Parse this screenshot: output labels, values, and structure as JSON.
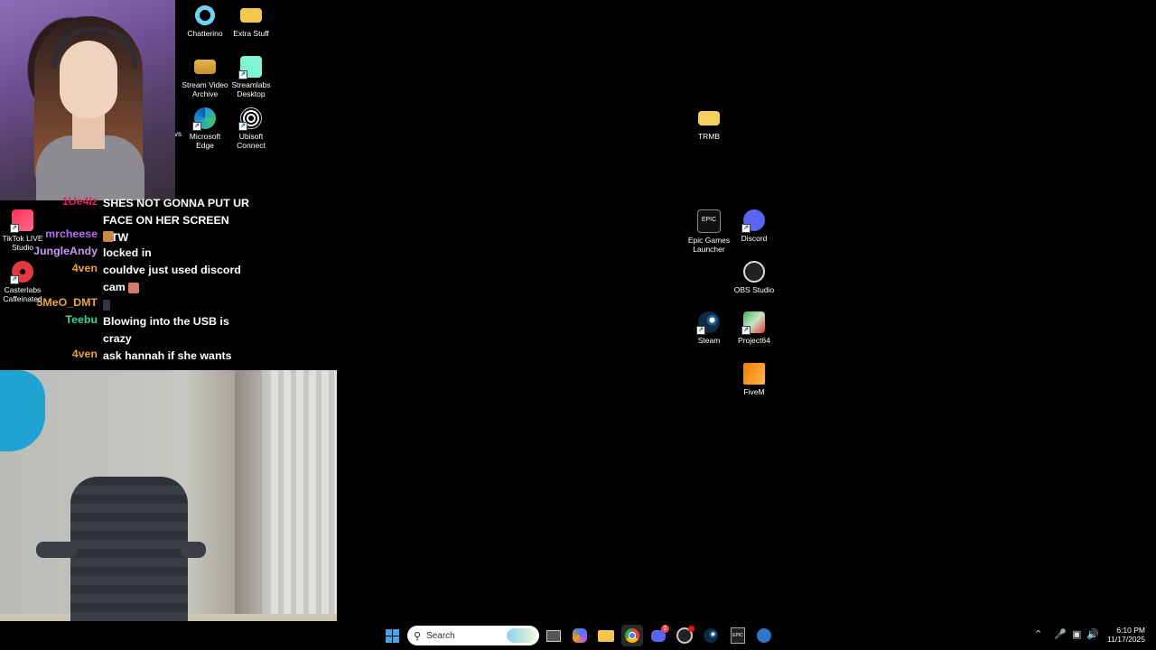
{
  "desktop_icons": {
    "chatterino": "Chatterino",
    "extra_stuff": "Extra Stuff",
    "stream_video_archive_1": "Stream Video",
    "stream_video_archive_2": "Archive",
    "streamlabs_1": "Streamlabs",
    "streamlabs_2": "Desktop",
    "edge_1": "Microsoft",
    "edge_2": "Edge",
    "ubisoft_1": "Ubisoft",
    "ubisoft_2": "Connect",
    "partial_label": "vs",
    "trmb": "TRMB",
    "epic_1": "Epic Games",
    "epic_2": "Launcher",
    "discord": "Discord",
    "obs": "OBS Studio",
    "steam": "Steam",
    "project64": "Project64",
    "fivem": "FiveM",
    "tiktok_1": "TikTok LIVE",
    "tiktok_2": "Studio",
    "casterlabs_1": "Casterlabs",
    "casterlabs_2": "Caffeinated"
  },
  "chat": {
    "messages": [
      {
        "user": "1Ue4lz",
        "color": "#e0245e",
        "text": "SHES NOT GONNA PUT UR FACE ON HER SCREEN BTW"
      },
      {
        "user": "mrcheese",
        "color": "#b86cf2",
        "text": ""
      },
      {
        "user": "JungleAndy",
        "color": "#c99af6",
        "text": "locked in"
      },
      {
        "user": "4ven",
        "color": "#e8a33a",
        "text": "couldve just used discord cam"
      },
      {
        "user": "5MeO_DMT",
        "color": "#e8a33a",
        "text": ""
      },
      {
        "user": "Teebu",
        "color": "#3bd38a",
        "text": "Blowing into the USB is crazy"
      },
      {
        "user": "4ven",
        "color": "#e8a33a",
        "text": "ask hannah if she wants"
      }
    ]
  },
  "taskbar": {
    "search_placeholder": "Search",
    "discord_badge": "2",
    "clock_time": "6:10 PM",
    "clock_date": "11/17/2025"
  },
  "colors": {
    "desktop_bg": "#000000",
    "chat_white": "#ffffff"
  }
}
